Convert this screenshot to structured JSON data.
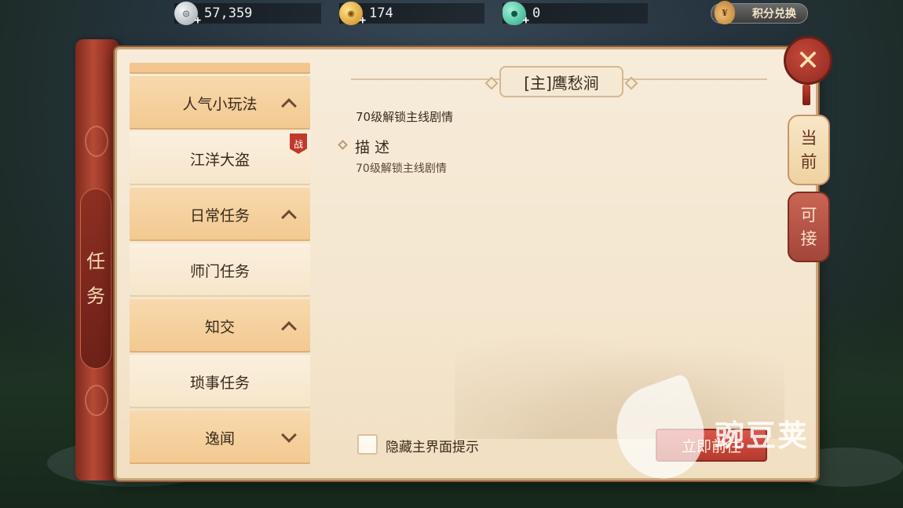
{
  "currencies": {
    "silver": {
      "value": "57,359",
      "icon": "silver-coin-icon"
    },
    "gold": {
      "value": "174",
      "icon": "gold-coin-icon"
    },
    "jade": {
      "value": "0",
      "icon": "jade-icon"
    }
  },
  "points_exchange": {
    "label": "积分兑换",
    "icon": "money-bag-icon"
  },
  "spine": {
    "title_1": "任",
    "title_2": "务"
  },
  "task_list": [
    {
      "label": "人气小玩法",
      "type": "group",
      "expanded": true
    },
    {
      "label": "江洋大盗",
      "type": "sub",
      "badge": "战"
    },
    {
      "label": "日常任务",
      "type": "group",
      "expanded": true
    },
    {
      "label": "师门任务",
      "type": "sub"
    },
    {
      "label": "知交",
      "type": "group",
      "expanded": true
    },
    {
      "label": "琐事任务",
      "type": "sub"
    },
    {
      "label": "逸闻",
      "type": "group",
      "expanded": false
    }
  ],
  "detail": {
    "title": "[主]鹰愁涧",
    "unlock_text": "70级解锁主线剧情",
    "desc_label": "描述",
    "desc_text": "70级解锁主线剧情"
  },
  "hide_hint": {
    "label": "隐藏主界面提示",
    "checked": false
  },
  "go_button": {
    "label": "立即前往"
  },
  "side_tabs": {
    "current": {
      "line1": "当",
      "line2": "前"
    },
    "available": {
      "line1": "可",
      "line2": "接"
    }
  },
  "close": {
    "glyph": "✕"
  },
  "watermark": {
    "text": "豌豆荚"
  },
  "colors": {
    "accent_red": "#b63a2f",
    "parchment": "#f4e6cf",
    "tab_gold": "#f2c990"
  }
}
